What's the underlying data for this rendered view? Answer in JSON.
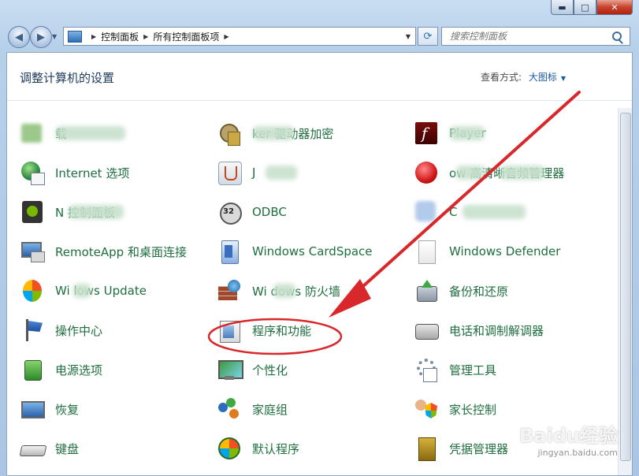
{
  "window": {
    "caption_buttons": {
      "minimize": "▬",
      "maximize": "□",
      "close": "✕"
    }
  },
  "nav": {
    "back": "◀",
    "forward": "▶",
    "breadcrumb": [
      "控制面板",
      "所有控制面板项"
    ],
    "search_placeholder": "搜索控制面板"
  },
  "header": {
    "title": "调整计算机的设置",
    "view_by_label": "查看方式:",
    "view_by_value": "大图标"
  },
  "items": [
    {
      "label": "        载",
      "icon": "flash-icon-blurred",
      "col": 0,
      "row": 0
    },
    {
      "label": "Internet 选项",
      "icon": "internet-options-icon",
      "col": 0,
      "row": 1
    },
    {
      "label": "N        控制面板",
      "icon": "nvidia-icon",
      "col": 0,
      "row": 2
    },
    {
      "label": "RemoteApp 和桌面连接",
      "icon": "remoteapp-icon",
      "col": 0,
      "row": 3
    },
    {
      "label": "Wi    lows Update",
      "icon": "windows-update-icon",
      "col": 0,
      "row": 4
    },
    {
      "label": "操作中心",
      "icon": "action-center-icon",
      "col": 0,
      "row": 5
    },
    {
      "label": "电源选项",
      "icon": "power-options-icon",
      "col": 0,
      "row": 6
    },
    {
      "label": "恢复",
      "icon": "recovery-icon",
      "col": 0,
      "row": 7
    },
    {
      "label": "键盘",
      "icon": "keyboard-icon",
      "col": 0,
      "row": 8
    },
    {
      "label": "        ker 驱动器加密",
      "icon": "bitlocker-icon",
      "col": 1,
      "row": 0
    },
    {
      "label": "J     ",
      "icon": "java-icon",
      "col": 1,
      "row": 1
    },
    {
      "label": "ODBC",
      "icon": "odbc-icon",
      "col": 1,
      "row": 2
    },
    {
      "label": "Windows CardSpace",
      "icon": "cardspace-icon",
      "col": 1,
      "row": 3
    },
    {
      "label": "Wi    dows 防火墙",
      "icon": "firewall-icon",
      "col": 1,
      "row": 4
    },
    {
      "label": "程序和功能",
      "icon": "programs-features-icon",
      "col": 1,
      "row": 5
    },
    {
      "label": "个性化",
      "icon": "personalization-icon",
      "col": 1,
      "row": 6
    },
    {
      "label": "家庭组",
      "icon": "homegroup-icon",
      "col": 1,
      "row": 7
    },
    {
      "label": "默认程序",
      "icon": "default-programs-icon",
      "col": 1,
      "row": 8
    },
    {
      "label": "        Player",
      "icon": "flash-player-icon",
      "col": 2,
      "row": 0
    },
    {
      "label": "     ow       高清晰音频管理器",
      "icon": "realtek-audio-icon",
      "col": 2,
      "row": 1
    },
    {
      "label": "C        ",
      "icon": "credentials-blurred-icon",
      "col": 2,
      "row": 2
    },
    {
      "label": "Windows Defender",
      "icon": "windows-defender-icon",
      "col": 2,
      "row": 3
    },
    {
      "label": "备份和还原",
      "icon": "backup-restore-icon",
      "col": 2,
      "row": 4
    },
    {
      "label": "电话和调制解调器",
      "icon": "phone-modem-icon",
      "col": 2,
      "row": 5
    },
    {
      "label": "管理工具",
      "icon": "admin-tools-icon",
      "col": 2,
      "row": 6
    },
    {
      "label": "家长控制",
      "icon": "parental-controls-icon",
      "col": 2,
      "row": 7
    },
    {
      "label": "凭据管理器",
      "icon": "credential-manager-icon",
      "col": 2,
      "row": 8
    }
  ],
  "highlight_item": "程序和功能",
  "watermark": {
    "brand": "Baidu经验",
    "url": "jingyan.baidu.com"
  },
  "colors": {
    "link_green": "#1f6e3f",
    "annotation_red": "#d8282c",
    "title_blue": "#1e395b"
  }
}
